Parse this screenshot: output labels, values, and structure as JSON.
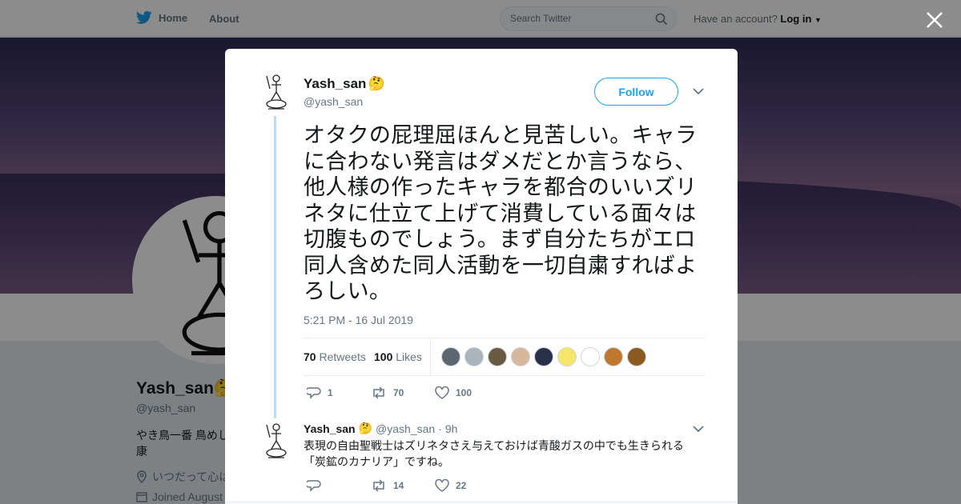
{
  "nav": {
    "home_label": "Home",
    "about_label": "About",
    "search_placeholder": "Search Twitter",
    "have_account": "Have an account?",
    "login_label": "Log in"
  },
  "profile_bg": {
    "name": "Yash_san",
    "handle": "@yash_san",
    "bio": "やき鳥一番 鳥めし 康",
    "location": "いつだって心は",
    "joined": "Joined August"
  },
  "tweet": {
    "name": "Yash_san",
    "emoji": "🤔",
    "handle": "@yash_san",
    "follow_label": "Follow",
    "text": "オタクの屁理屈ほんと見苦しい。キャラに合わない発言はダメだとか言うなら、他人様の作ったキャラを都合のいいズリネタに仕立て上げて消費している面々は切腹ものでしょう。まず自分たちがエロ同人含めた同人活動を一切自粛すればよろしい。",
    "timestamp": "5:21 PM - 16 Jul 2019",
    "retweets_count": "70",
    "retweets_label": "Retweets",
    "likes_count": "100",
    "likes_label": "Likes",
    "actions": {
      "replies": "1",
      "retweets": "70",
      "likes": "100"
    },
    "likers": [
      "#5c6670",
      "#aab4bc",
      "#6a5a40",
      "#d8b89a",
      "#2a2f4a",
      "#f5e56a",
      "#ffffff",
      "#c07830",
      "#8a5a20"
    ]
  },
  "reply": {
    "name": "Yash_san",
    "emoji": "🤔",
    "handle": "@yash_san",
    "time": "9h",
    "text": "表現の自由聖戦士はズリネタさえ与えておけば青酸ガスの中でも生きられる「炭鉱のカナリア」ですね。",
    "actions": {
      "replies": "",
      "retweets": "14",
      "likes": "22"
    }
  }
}
